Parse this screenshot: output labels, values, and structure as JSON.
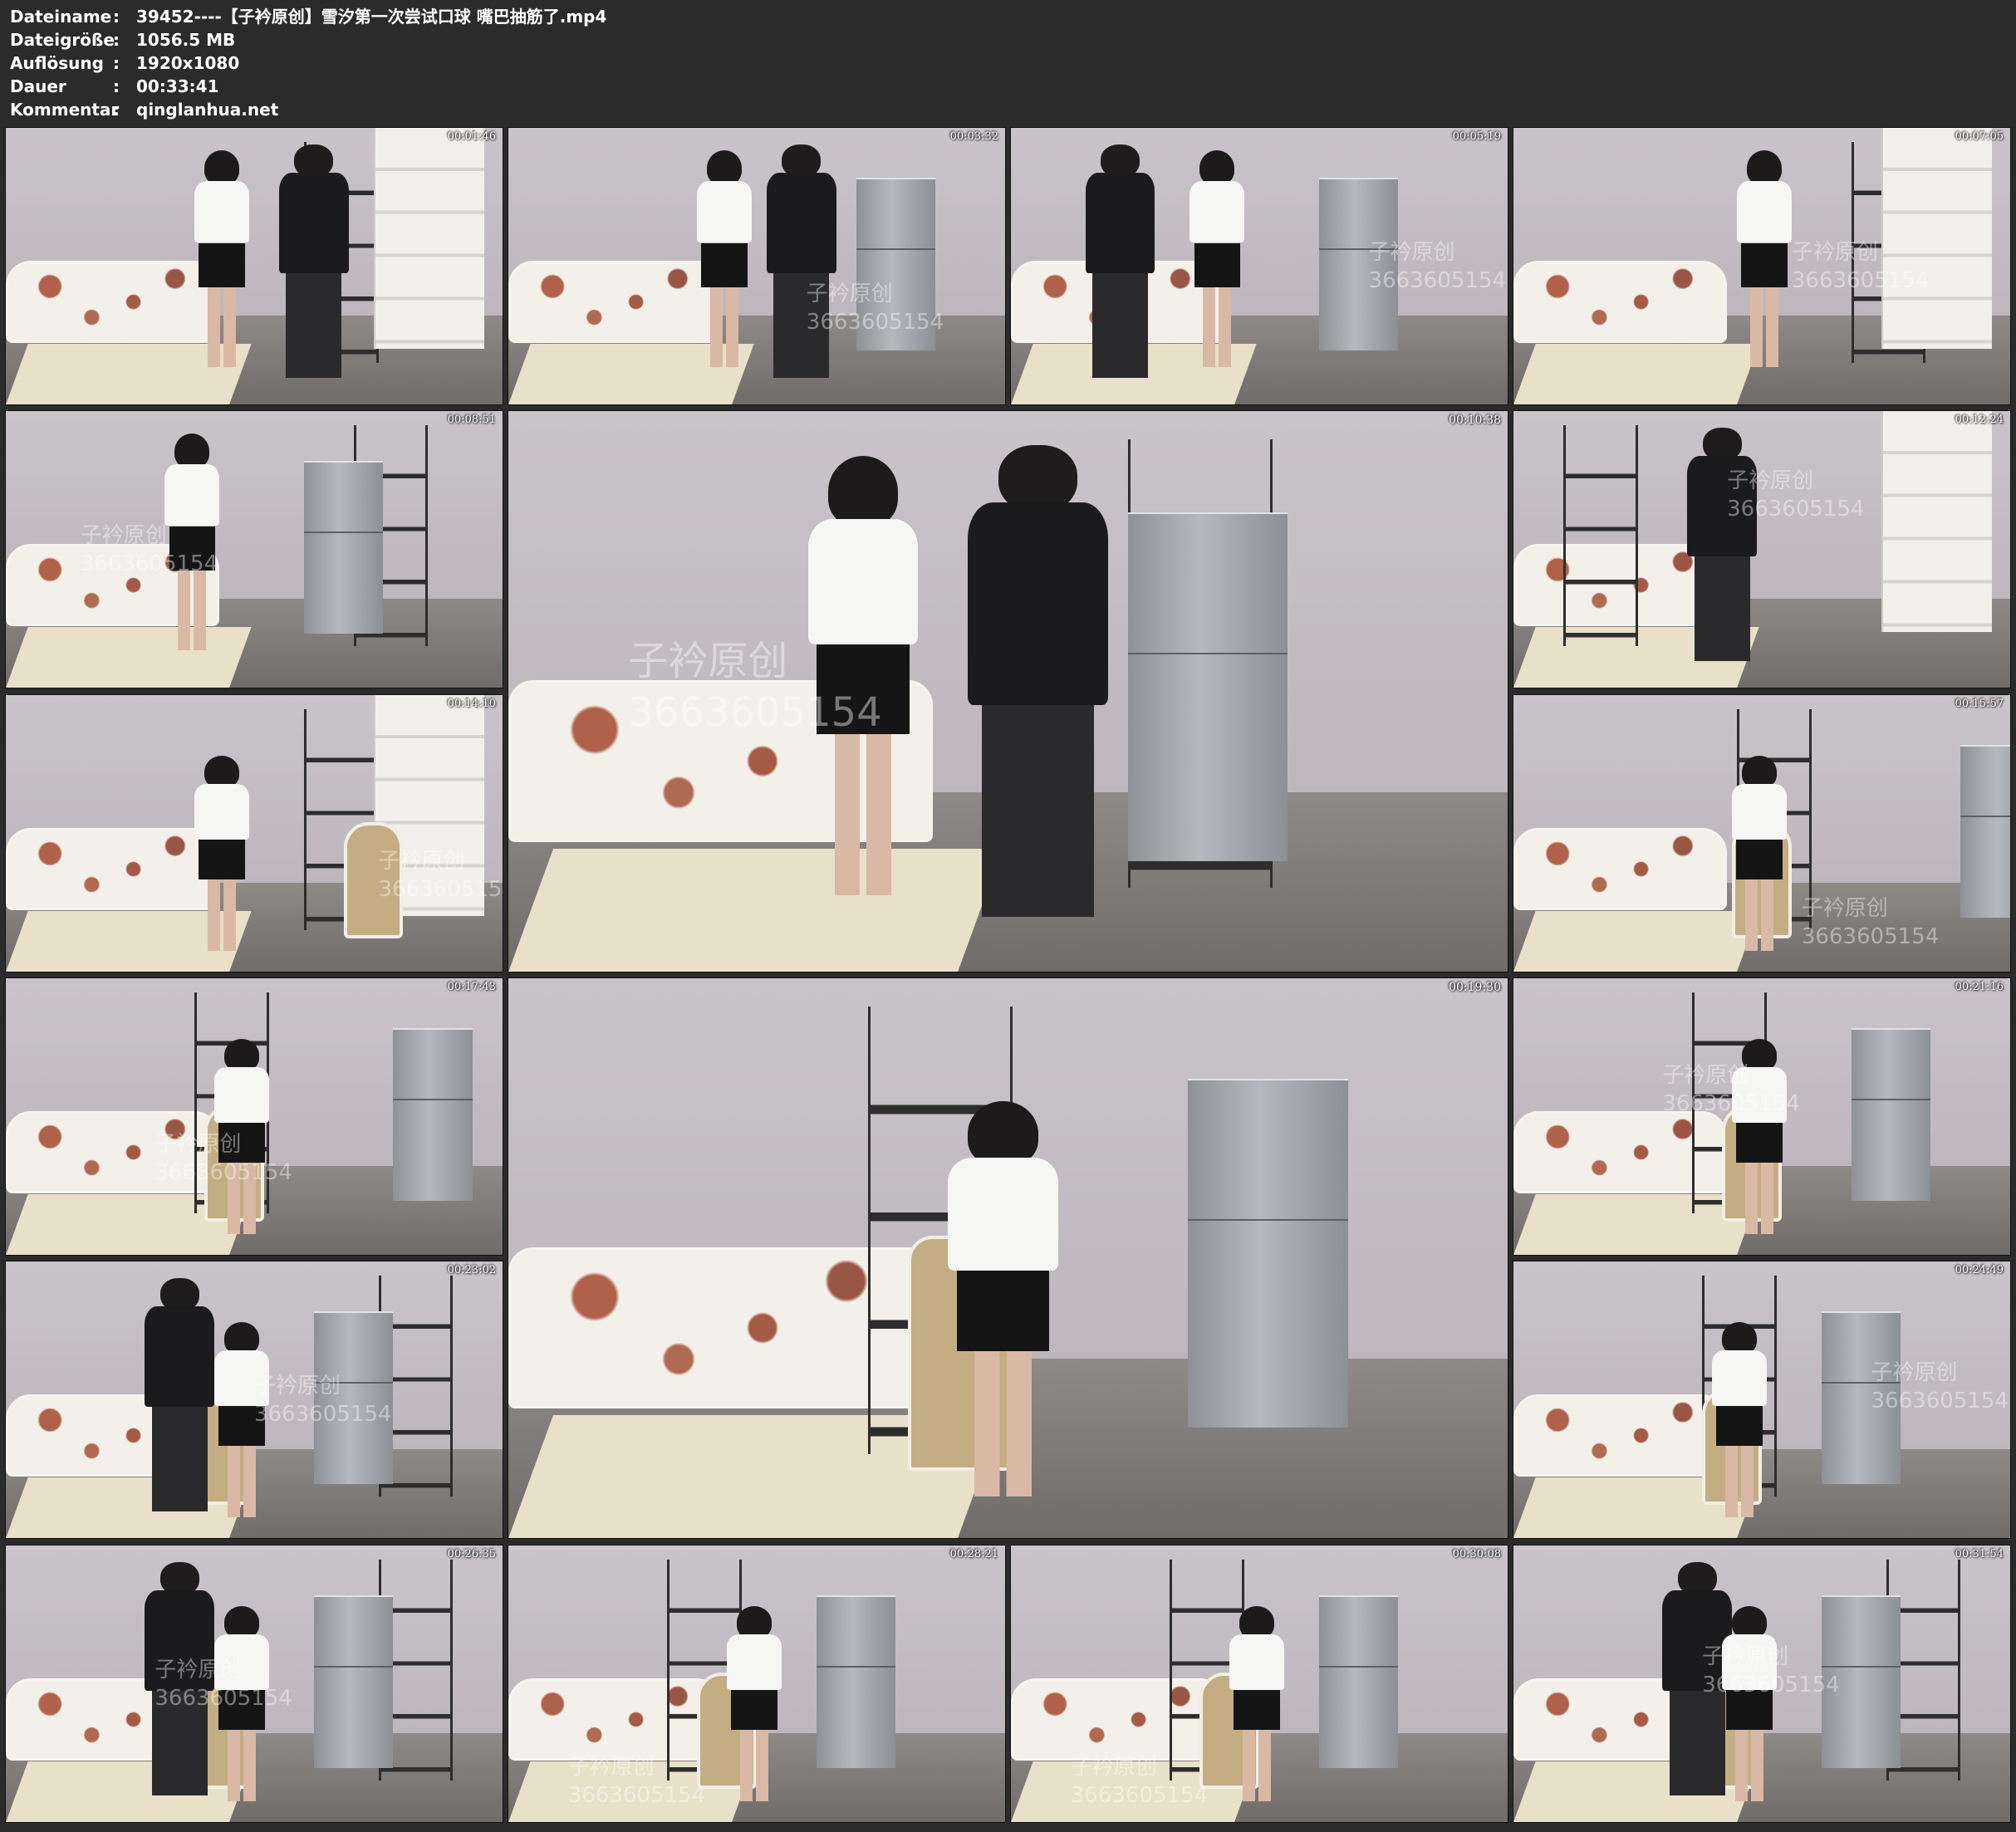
{
  "info": {
    "rows": [
      {
        "key": "Dateiname",
        "sep": ":",
        "value": "39452----【子衿原创】雪汐第一次尝试口球 嘴巴抽筋了.mp4"
      },
      {
        "key": "Dateigröße",
        "sep": ":",
        "value": "1056.5 MB"
      },
      {
        "key": "Auflösung",
        "sep": ":",
        "value": "1920x1080"
      },
      {
        "key": "Dauer",
        "sep": ":",
        "value": "00:33:41"
      },
      {
        "key": "Kommentar",
        "sep": ":",
        "value": "qinglanhua.net"
      }
    ]
  },
  "watermark": {
    "line1": "子衿原创",
    "line2": "3663605154"
  },
  "thumbnails": [
    {
      "time": "00:01:46"
    },
    {
      "time": "00:03:32"
    },
    {
      "time": "00:05:19"
    },
    {
      "time": "00:07:05"
    },
    {
      "time": "00:08:51"
    },
    {
      "time": "00:10:38"
    },
    {
      "time": "00:12:24"
    },
    {
      "time": "00:14:10"
    },
    {
      "time": "00:15:57"
    },
    {
      "time": "00:17:43"
    },
    {
      "time": "00:19:30"
    },
    {
      "time": "00:21:16"
    },
    {
      "time": "00:23:02"
    },
    {
      "time": "00:24:49"
    },
    {
      "time": "00:26:35"
    },
    {
      "time": "00:28:21"
    },
    {
      "time": "00:30:08"
    },
    {
      "time": "00:31:54"
    }
  ],
  "colors": {
    "background": "#2b2b2b",
    "text": "#ffffff"
  }
}
